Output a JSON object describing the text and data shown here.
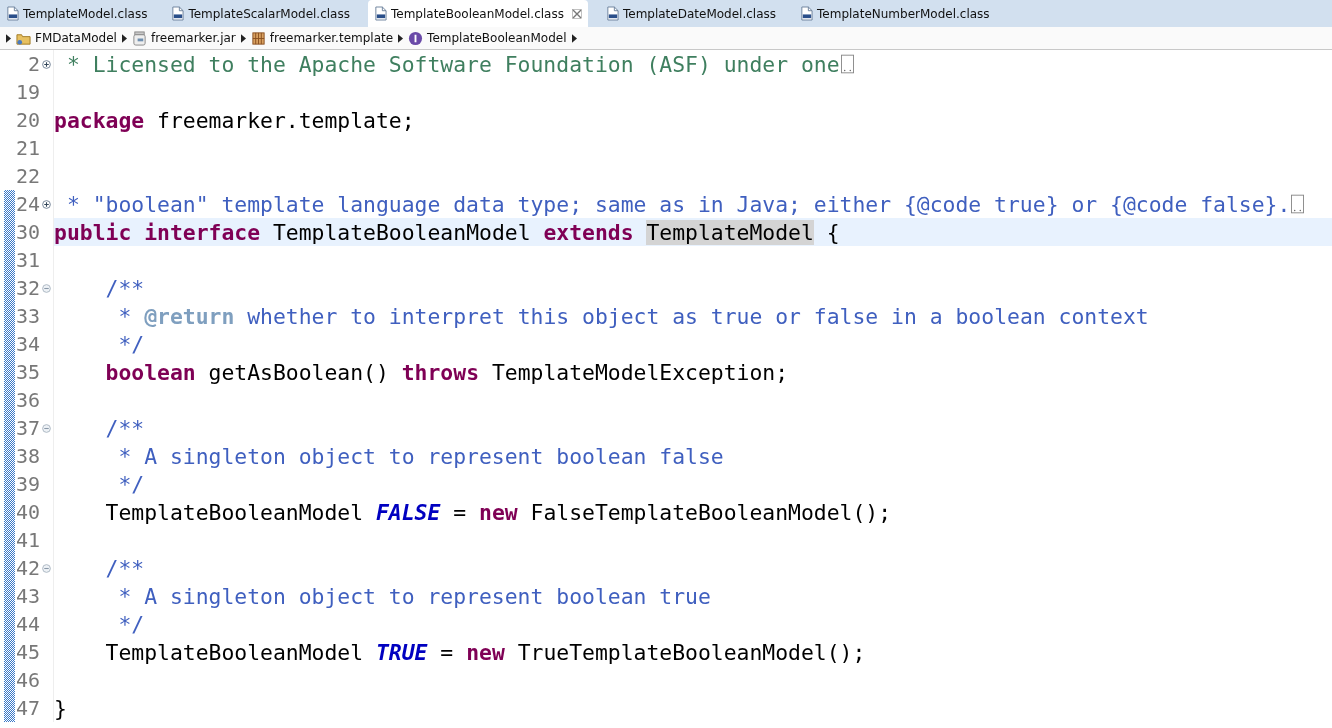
{
  "tabs": [
    {
      "label": "TemplateModel.class",
      "selected": false
    },
    {
      "label": "TemplateScalarModel.class",
      "selected": false
    },
    {
      "label": "TemplateBooleanModel.class",
      "selected": true
    },
    {
      "label": "TemplateDateModel.class",
      "selected": false
    },
    {
      "label": "TemplateNumberModel.class",
      "selected": false
    }
  ],
  "breadcrumb": [
    {
      "label": "FMDataModel",
      "kind": "project"
    },
    {
      "label": "freemarker.jar",
      "kind": "jar"
    },
    {
      "label": "freemarker.template",
      "kind": "package"
    },
    {
      "label": "TemplateBooleanModel",
      "kind": "interface"
    }
  ],
  "lines": [
    {
      "number": "2",
      "collapsed": true,
      "changed": false,
      "current": false,
      "tokens": [
        {
          "t": " * Licensed to the Apache Software Foundation (ASF) under one",
          "kind": "comment"
        }
      ]
    },
    {
      "number": "19",
      "changed": false,
      "current": false
    },
    {
      "number": "20",
      "changed": false,
      "current": false,
      "tokens": [
        {
          "t": "package",
          "kind": "keyword"
        },
        {
          "t": " freemarker.template;",
          "kind": "plain"
        }
      ]
    },
    {
      "number": "21",
      "changed": false,
      "current": false
    },
    {
      "number": "22",
      "changed": false,
      "current": false
    },
    {
      "number": "24",
      "collapsed": true,
      "changed": true,
      "current": false,
      "tokens": [
        {
          "t": " * \"boolean\" template language data type; same as in Java; either {@code true} or {@code false}.",
          "kind": "javadoc"
        }
      ]
    },
    {
      "number": "30",
      "changed": true,
      "current": true,
      "tokens": [
        {
          "t": "public",
          "kind": "keyword"
        },
        {
          "t": " interface",
          "kind": "keyword"
        },
        {
          "t": " TemplateBooleanModel ",
          "kind": "plain"
        },
        {
          "t": "extends ",
          "kind": "keyword"
        },
        {
          "t": "TemplateModel",
          "kind": "occurrence"
        },
        {
          "t": " {",
          "kind": "plain"
        }
      ]
    },
    {
      "number": "31",
      "changed": true,
      "current": false
    },
    {
      "number": "32",
      "collapsed": false,
      "changed": true,
      "current": false,
      "tokens": [
        {
          "t": "    /**",
          "kind": "javadoc"
        }
      ]
    },
    {
      "number": "33",
      "changed": true,
      "current": false,
      "tokens": [
        {
          "t": "     * ",
          "kind": "javadoc"
        },
        {
          "t": "@return",
          "kind": "javadoc_tag"
        },
        {
          "t": " whether to interpret this object as true or false in a boolean context",
          "kind": "javadoc"
        }
      ]
    },
    {
      "number": "34",
      "changed": true,
      "current": false,
      "tokens": [
        {
          "t": "     */",
          "kind": "javadoc"
        }
      ]
    },
    {
      "number": "35",
      "changed": true,
      "current": false,
      "tokens": [
        {
          "t": "    boolean",
          "kind": "keyword"
        },
        {
          "t": " getAsBoolean() ",
          "kind": "plain"
        },
        {
          "t": "throws",
          "kind": "keyword"
        },
        {
          "t": " TemplateModelException;",
          "kind": "plain"
        }
      ]
    },
    {
      "number": "36",
      "changed": true,
      "current": false
    },
    {
      "number": "37",
      "collapsed": false,
      "changed": true,
      "current": false,
      "tokens": [
        {
          "t": "    /**",
          "kind": "javadoc"
        }
      ]
    },
    {
      "number": "38",
      "changed": true,
      "current": false,
      "tokens": [
        {
          "t": "     * A singleton object to represent boolean false",
          "kind": "javadoc"
        }
      ]
    },
    {
      "number": "39",
      "changed": true,
      "current": false,
      "tokens": [
        {
          "t": "     */",
          "kind": "javadoc"
        }
      ]
    },
    {
      "number": "40",
      "changed": true,
      "current": false,
      "tokens": [
        {
          "t": "    TemplateBooleanModel ",
          "kind": "plain"
        },
        {
          "t": "FALSE",
          "kind": "static_field"
        },
        {
          "t": " = ",
          "kind": "plain"
        },
        {
          "t": "new",
          "kind": "keyword"
        },
        {
          "t": " FalseTemplateBooleanModel();",
          "kind": "plain"
        }
      ]
    },
    {
      "number": "41",
      "changed": true,
      "current": false
    },
    {
      "number": "42",
      "collapsed": false,
      "changed": true,
      "current": false,
      "tokens": [
        {
          "t": "    /**",
          "kind": "javadoc"
        }
      ]
    },
    {
      "number": "43",
      "changed": true,
      "current": false,
      "tokens": [
        {
          "t": "     * A singleton object to represent boolean true",
          "kind": "javadoc"
        }
      ]
    },
    {
      "number": "44",
      "changed": true,
      "current": false,
      "tokens": [
        {
          "t": "     */",
          "kind": "javadoc"
        }
      ]
    },
    {
      "number": "45",
      "changed": true,
      "current": false,
      "tokens": [
        {
          "t": "    TemplateBooleanModel ",
          "kind": "plain"
        },
        {
          "t": "TRUE",
          "kind": "static_field"
        },
        {
          "t": " = ",
          "kind": "plain"
        },
        {
          "t": "new",
          "kind": "keyword"
        },
        {
          "t": " TrueTemplateBooleanModel();",
          "kind": "plain"
        }
      ]
    },
    {
      "number": "46",
      "changed": true,
      "current": false
    },
    {
      "number": "47",
      "changed": true,
      "current": false,
      "tokens": [
        {
          "t": "}",
          "kind": "plain"
        }
      ]
    }
  ]
}
